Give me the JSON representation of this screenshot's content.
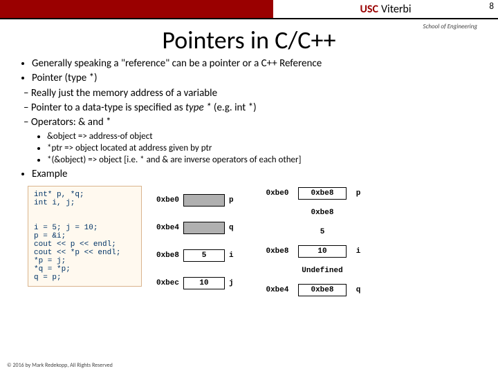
{
  "page_number": "8",
  "brand": {
    "usc": "USC",
    "viterbi": "Viterbi",
    "school": "School of Engineering"
  },
  "title": "Pointers in C/C++",
  "bullets": {
    "b1": "Generally speaking a \"reference\" can be a pointer or a C++ Reference",
    "b2": "Pointer (type *)",
    "s1": "Really just the memory address of a variable",
    "s2a": "Pointer to a data-type is specified as ",
    "s2b": "type *",
    "s2c": " (e.g. int *)",
    "s3": "Operators: & and *",
    "t1": "&object => address-of object",
    "t2": "*ptr => object located at address given by ptr",
    "t3": "*(&object) => object [i.e. * and & are inverse operators of each other]",
    "ex": "Example"
  },
  "code": "int* p, *q;\nint i, j;\n\n\ni = 5; j = 10;\np = &i;\ncout << p << endl;\ncout << *p << endl;\n*p = j;\n*q = *p;\nq = p;",
  "mem_left": {
    "r0": {
      "addr": "0xbe0",
      "val": "",
      "lab": "p"
    },
    "r1": {
      "addr": "0xbe4",
      "val": "",
      "lab": "q"
    },
    "r2": {
      "addr": "0xbe8",
      "val": "5",
      "lab": "i"
    },
    "r3": {
      "addr": "0xbec",
      "val": "10",
      "lab": "j"
    }
  },
  "mem_right": {
    "r0": {
      "addr": "0xbe0",
      "val": "0xbe8",
      "lab": "p"
    },
    "r1": {
      "addr": "",
      "val": "0xbe8",
      "lab": ""
    },
    "r2": {
      "addr": "",
      "val": "5",
      "lab": ""
    },
    "r3": {
      "addr": "0xbe8",
      "val": "10",
      "lab": "i"
    },
    "r4": {
      "addr": "",
      "val": "Undefined",
      "lab": ""
    },
    "r5": {
      "addr": "0xbe4",
      "val": "0xbe8",
      "lab": "q"
    }
  },
  "footer": "© 2016 by Mark Redekopp, All Rights Reserved"
}
